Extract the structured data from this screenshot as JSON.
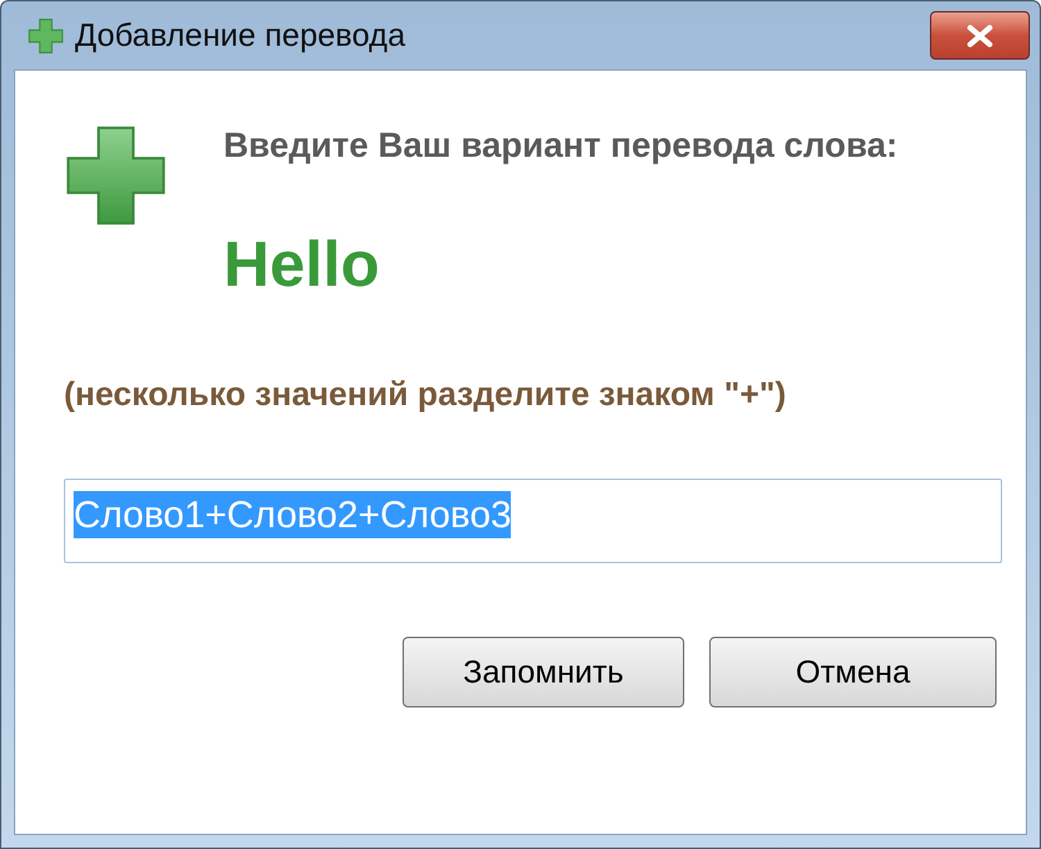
{
  "window": {
    "title": "Добавление перевода"
  },
  "prompt": "Введите Ваш вариант перевода слова:",
  "word": "Hello",
  "hint": "(несколько значений разделите знаком \"+\")",
  "input": {
    "value": "Слово1+Слово2+Слово3",
    "text_selected": true
  },
  "buttons": [
    {
      "label": "Запомнить"
    },
    {
      "label": "Отмена"
    }
  ]
}
